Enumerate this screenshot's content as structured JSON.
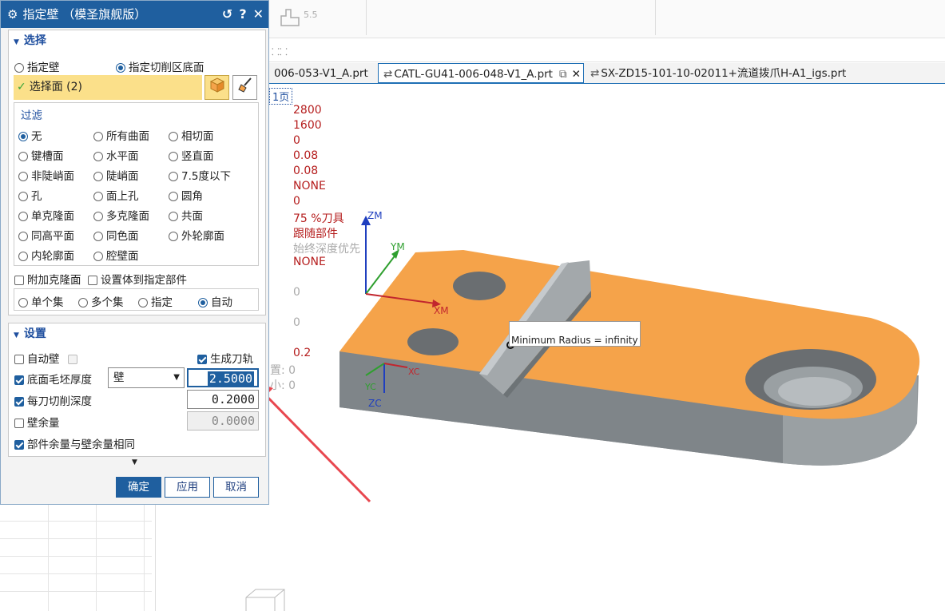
{
  "dialog": {
    "title": "指定壁 （模圣旗舰版）",
    "tools": {
      "reset": "↺",
      "help": "?",
      "close": "✕"
    },
    "select_section": {
      "header": "选择",
      "mode_options": [
        "指定壁",
        "指定切削区底面"
      ],
      "mode_selected": 1,
      "select_face_label": "选择面 (2)",
      "filter": {
        "title": "过滤",
        "options": [
          "无",
          "所有曲面",
          "相切面",
          "键槽面",
          "水平面",
          "竖直面",
          "非陡峭面",
          "陡峭面",
          "7.5度以下",
          "孔",
          "面上孔",
          "圆角",
          "单克隆面",
          "多克隆面",
          "共面",
          "同高平面",
          "同色面",
          "外轮廓面",
          "内轮廓面",
          "腔壁面"
        ],
        "selected": 0
      },
      "add_clone_label": "附加克隆面",
      "set_body_label": "设置体到指定部件",
      "collection_options": [
        "单个集",
        "多个集",
        "指定",
        "自动"
      ],
      "collection_selected": 3
    },
    "settings_section": {
      "header": "设置",
      "auto_wall_label": "自动壁",
      "gen_toolpath_label": "生成刀轨",
      "floor_stock_label": "底面毛坯厚度",
      "floor_stock_mode": "壁",
      "floor_stock_value": "2.5000",
      "depth_per_cut_label": "每刀切削深度",
      "depth_per_cut_value": "0.2000",
      "wall_stock_label": "壁余量",
      "wall_stock_value": "0.0000",
      "part_stock_same_label": "部件余量与壁余量相同"
    },
    "buttons": {
      "ok": "确定",
      "apply": "应用",
      "cancel": "取消"
    }
  },
  "toolbar": {
    "num_label": "5.5",
    "grid_icon": "⸬⸬"
  },
  "tabs": [
    {
      "label": "006-053-V1_A.prt",
      "active": false
    },
    {
      "label": "CATL-GU41-006-048-V1_A.prt",
      "active": true
    },
    {
      "label": "SX-ZD15-101-10-02011+流道拨爪H-A1_igs.prt",
      "active": false
    }
  ],
  "viewport": {
    "page_label": "1页",
    "params": [
      "2800",
      "1600",
      "0",
      "0.08",
      "0.08",
      "NONE",
      "0",
      "75  %刀具",
      "跟随部件",
      "始终深度优先",
      "NONE",
      "0",
      "0",
      "0.2",
      "置:  0",
      "小:  0"
    ],
    "tooltip": "Minimum Radius = infinity",
    "axes": {
      "zm": "ZM",
      "ym": "YM",
      "xm": "XM",
      "yc": "YC",
      "xc": "XC",
      "zc": "ZC"
    }
  },
  "colors": {
    "title_bar": "#1f5f9f",
    "selected_face": "#fbe08a",
    "part_top": "#f5a34a",
    "part_side": "#8e9497",
    "arrow": "#e8474f",
    "param_red": "#b51d1d"
  }
}
